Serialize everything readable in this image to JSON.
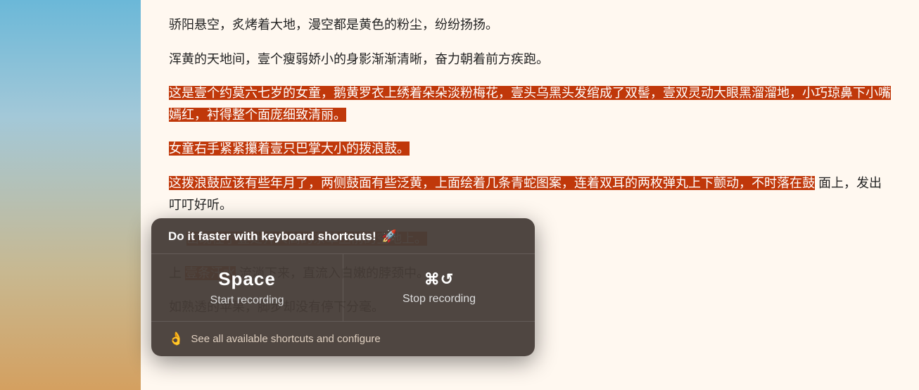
{
  "background": {
    "colors": {
      "highlight": "#c0380a",
      "popup_bg": "rgba(70,60,55,0.95)"
    }
  },
  "content": {
    "paragraphs": [
      {
        "id": "p1",
        "text": "骄阳悬空，炙烤着大地，漫空都是黄色的粉尘，纷纷扬扬。",
        "highlighted": false
      },
      {
        "id": "p2",
        "text": "浑黄的天地间，壹个瘦弱娇小的身影渐渐清晰，奋力朝着前方疾跑。",
        "highlighted": false
      },
      {
        "id": "p3",
        "text": "这是壹个约莫六七岁的女童，鹅黄罗衣上绣着朵朵淡粉梅花，壹头乌黑头发绾成了双髻，壹双灵动大眼黑溜溜地，小巧琼鼻下小嘴嫣红，衬得整个面庞细致清丽。",
        "highlighted": true
      },
      {
        "id": "p4",
        "text": "女童右手紧紧攥着壹只巴掌大小的拨浪鼓。",
        "highlighted": true
      },
      {
        "id": "p5",
        "text": "这拨浪鼓应该有些年月了，两侧鼓面有些泛黄，上面绘着几条青蛇图案，连着双耳的两枚弹丸上下颤动，不时落在鼓面上，发出叮叮好听。",
        "highlighted": true,
        "partial": true,
        "visible_text": "这拨浪鼓应该有些年月了，两侧鼓面有些泛黄，上面绘着几条青蛇图案，连着双耳的两枚弹丸上下颤动，不时落在鼓面上，发出叮叮好听。"
      }
    ],
    "more_lines": [
      "出现在了壹处齐人高的杂草丛前的空地上。",
      "上壹条汗水流淌下来，直流入白嫩的脖颈中。",
      "如熟透的苹果，脚步却没有停下分毫。"
    ]
  },
  "popup": {
    "header": "Do it faster with keyboard shortcuts!",
    "header_icon": "🚀",
    "shortcuts": [
      {
        "key": "Space",
        "label": "Start recording"
      },
      {
        "key": "⌘↺",
        "label": "Stop recording"
      }
    ],
    "footer_icon": "👌",
    "footer_text": "See all available shortcuts and configure"
  }
}
